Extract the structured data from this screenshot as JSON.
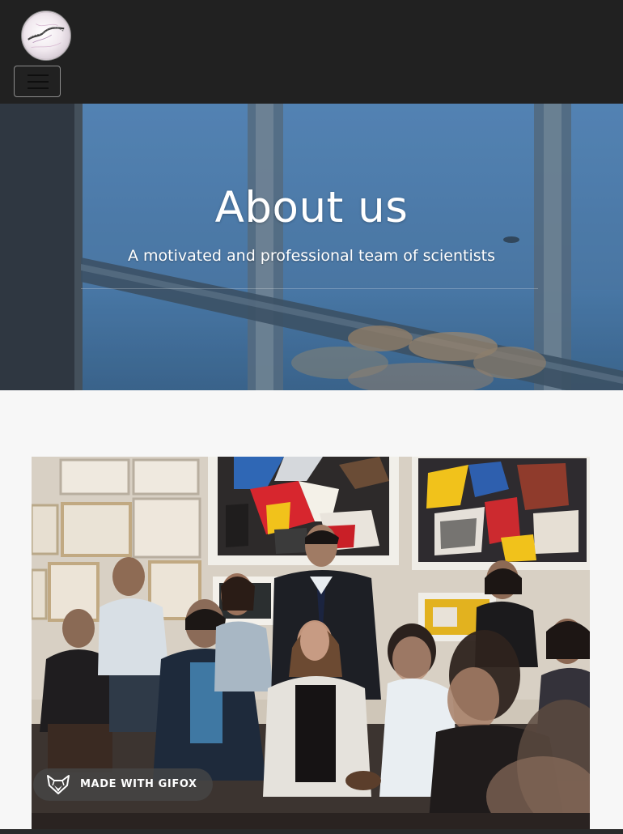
{
  "navbar": {
    "logo_icon": "site-logo-icon",
    "toggler_icon": "hamburger-menu-icon",
    "colors": {
      "background": "#212121",
      "toggler_border": "#8d8d8d"
    }
  },
  "hero": {
    "title": "About us",
    "subtitle": "A motivated and professional team of scientists",
    "colors": {
      "text": "#ffffff",
      "overlay": "#3b5a77"
    }
  },
  "photo": {
    "badge": {
      "icon": "fox-logo-icon",
      "label": "MADE WITH GIFOX"
    }
  },
  "page": {
    "colors": {
      "background": "#f7f7f7"
    }
  }
}
